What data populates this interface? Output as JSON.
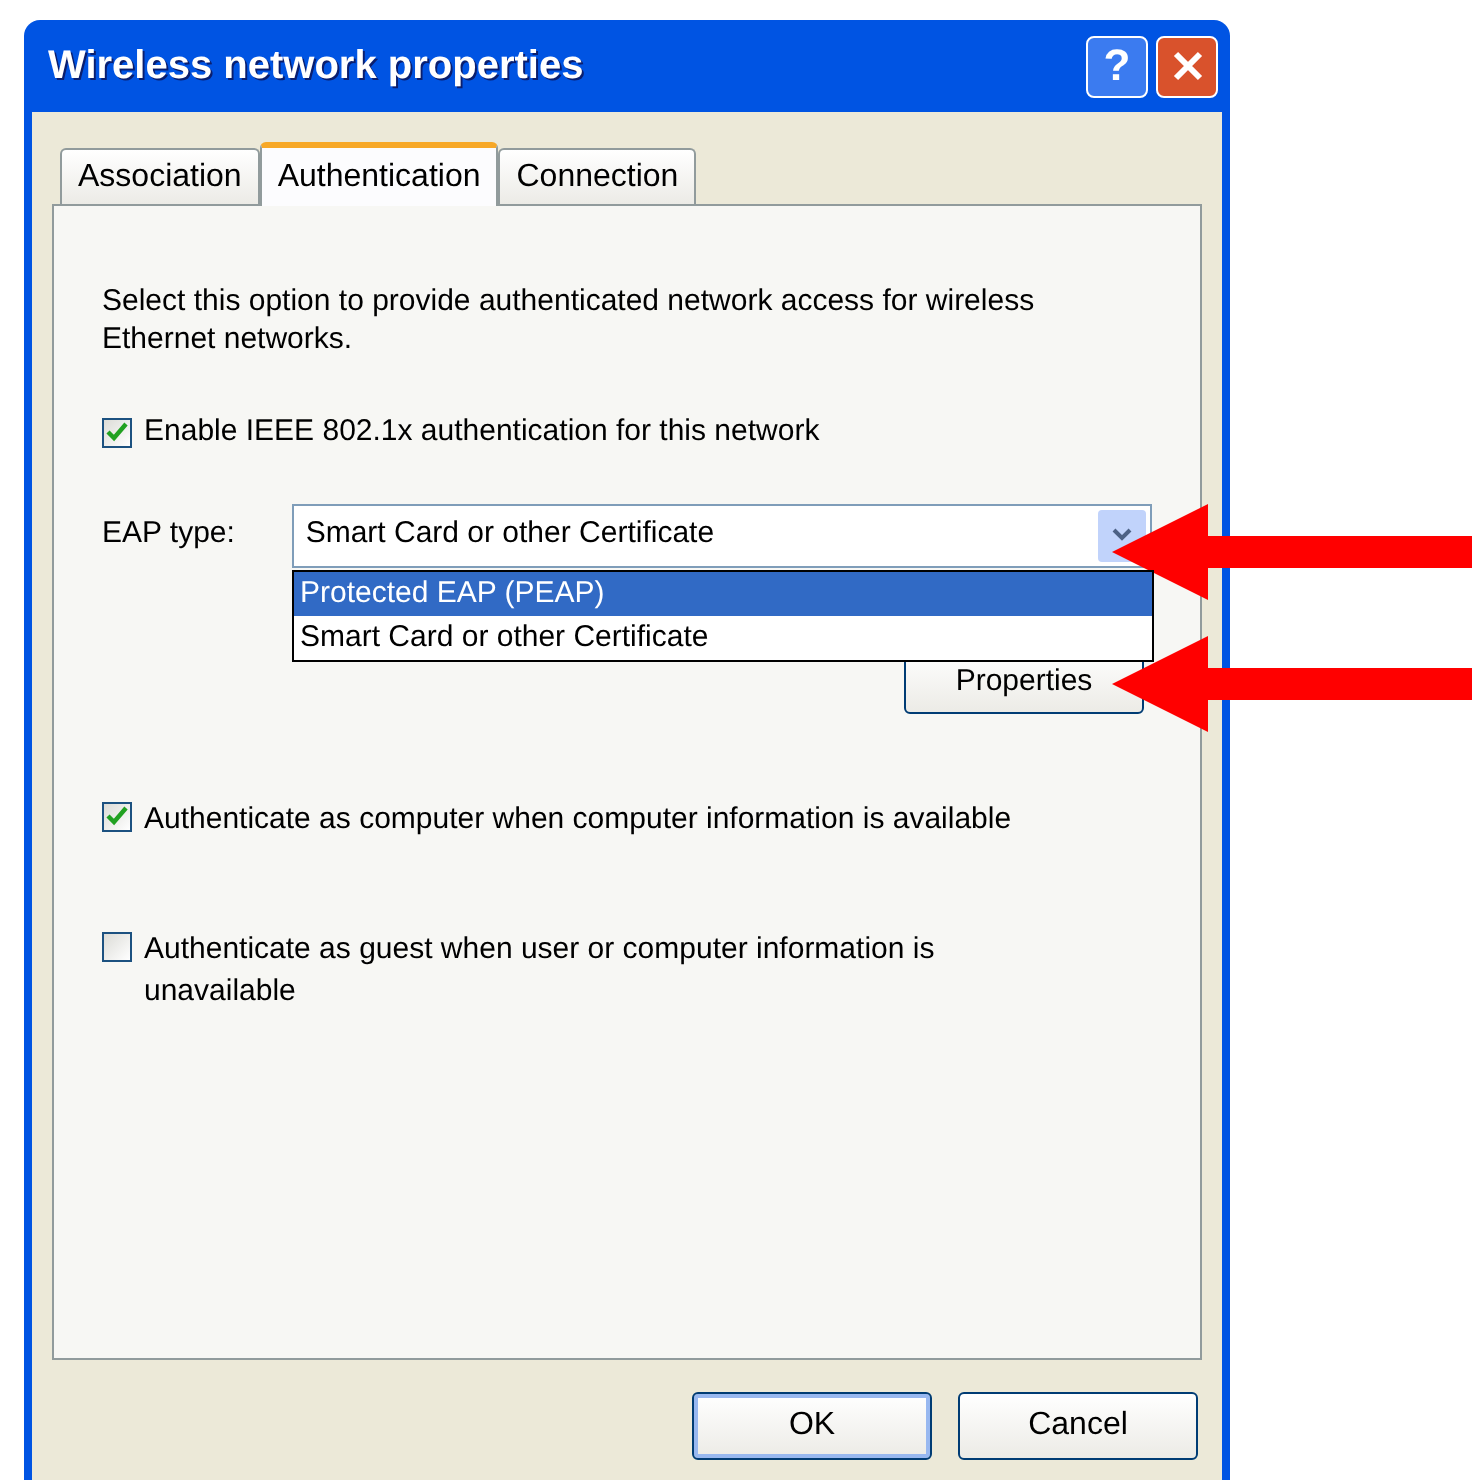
{
  "window": {
    "title": "Wireless network properties",
    "help_button": "?"
  },
  "tabs": [
    {
      "label": "Association",
      "selected": false
    },
    {
      "label": "Authentication",
      "selected": true
    },
    {
      "label": "Connection",
      "selected": false
    }
  ],
  "description": "Select this option to provide authenticated network access for wireless Ethernet networks.",
  "enable_8021x": {
    "label": "Enable IEEE 802.1x authentication for this network",
    "checked": true
  },
  "eap_type": {
    "label": "EAP type:",
    "value": "Smart Card or other Certificate",
    "expanded": true,
    "options": [
      {
        "label": "Protected EAP (PEAP)",
        "highlighted": true
      },
      {
        "label": "Smart Card or other Certificate",
        "highlighted": false
      }
    ]
  },
  "properties_button": "Properties",
  "checkboxes": [
    {
      "label": "Authenticate as computer when computer information is available",
      "checked": true
    },
    {
      "label": "Authenticate as guest when user or computer information is unavailable",
      "checked": false
    }
  ],
  "buttons": [
    {
      "label": "OK",
      "default": true
    },
    {
      "label": "Cancel",
      "default": false
    }
  ]
}
